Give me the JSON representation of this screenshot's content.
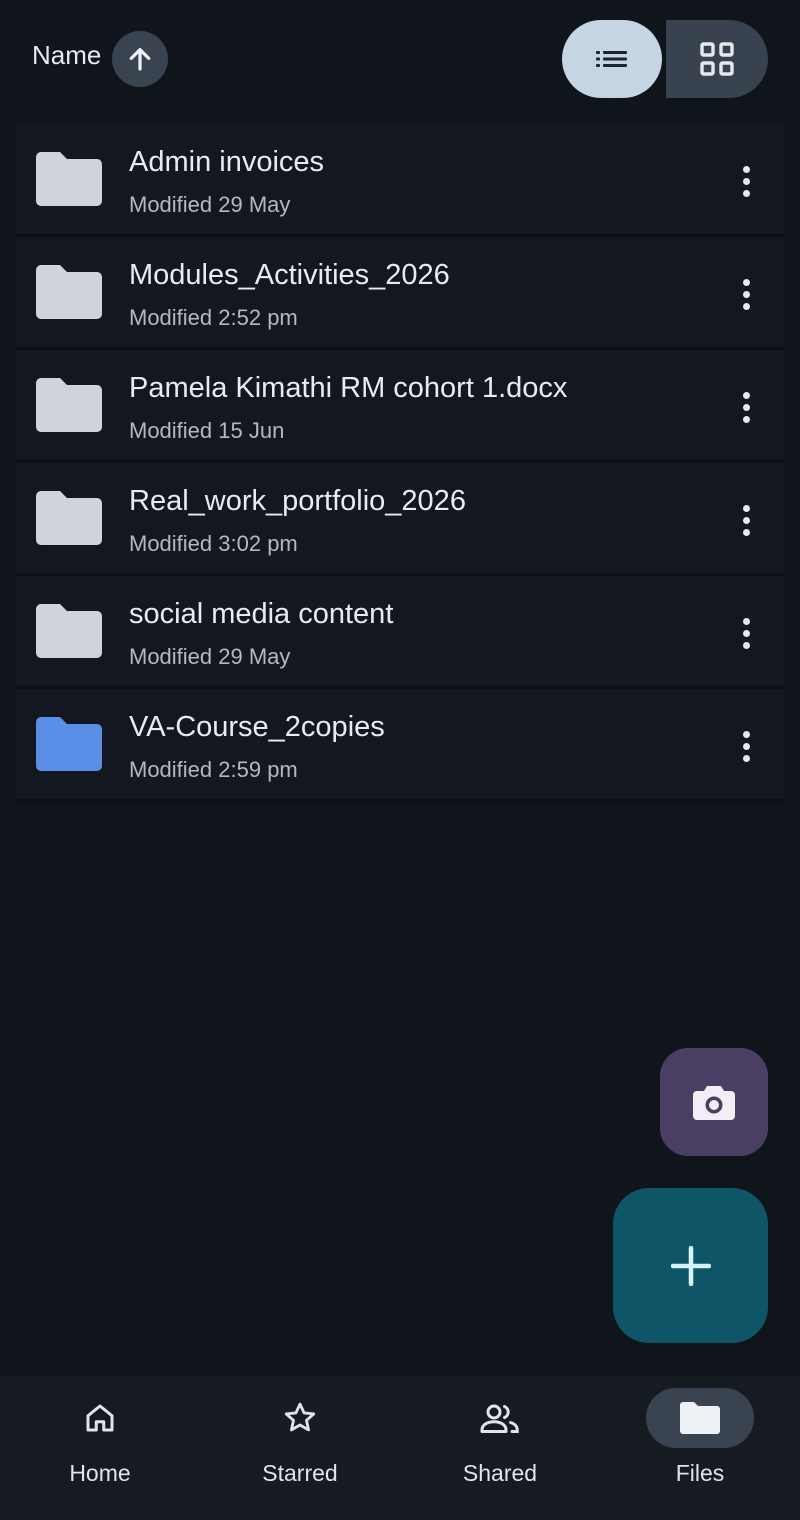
{
  "header": {
    "sort_label": "Name",
    "sort_direction_icon": "arrow-up-icon",
    "view_modes": [
      "list-view-icon",
      "grid-view-icon"
    ],
    "active_view": "list"
  },
  "files": [
    {
      "name": "Admin invoices",
      "modified": "Modified 29 May",
      "color": "#d0d3d9"
    },
    {
      "name": "Modules_Activities_2026",
      "modified": "Modified 2:52 pm",
      "color": "#d0d3d9"
    },
    {
      "name": "Pamela Kimathi RM cohort 1.docx",
      "modified": "Modified 15 Jun",
      "color": "#d0d3d9"
    },
    {
      "name": "Real_work_portfolio_2026",
      "modified": "Modified 3:02 pm",
      "color": "#d0d3d9"
    },
    {
      "name": "social media content",
      "modified": "Modified 29 May",
      "color": "#d0d3d9"
    },
    {
      "name": "VA-Course_2copies",
      "modified": "Modified 2:59 pm",
      "color": "#5b8ee6"
    }
  ],
  "fabs": {
    "camera_icon": "camera-icon",
    "add_icon": "plus-icon"
  },
  "nav": {
    "items": [
      {
        "label": "Home",
        "icon": "home-icon"
      },
      {
        "label": "Starred",
        "icon": "star-icon"
      },
      {
        "label": "Shared",
        "icon": "people-icon"
      },
      {
        "label": "Files",
        "icon": "folder-icon"
      }
    ],
    "active": "Files"
  }
}
